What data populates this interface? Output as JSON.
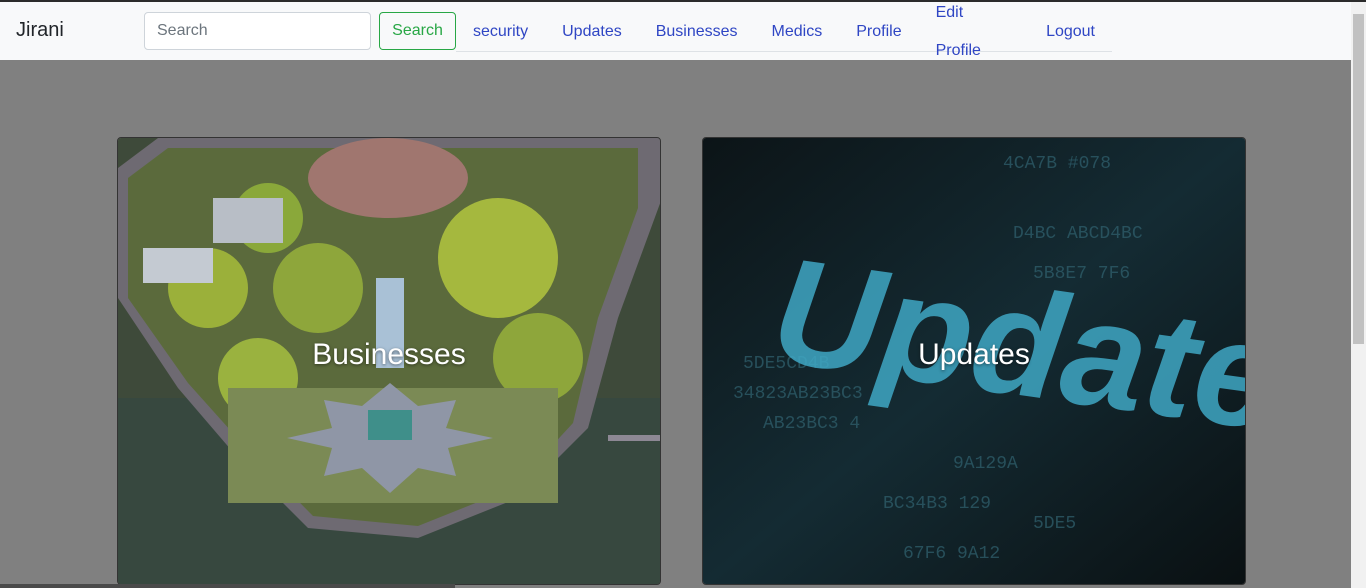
{
  "navbar": {
    "brand": "Jirani",
    "search": {
      "placeholder": "Search",
      "value": ""
    },
    "search_button": "Search",
    "links": [
      "security",
      "Updates",
      "Businesses",
      "Medics",
      "Profile",
      "Edit Profile",
      "Logout"
    ]
  },
  "cards": [
    {
      "title": "Businesses",
      "image": "aerial-island-photo"
    },
    {
      "title": "Updates",
      "image": "update-text-photo"
    }
  ],
  "colors": {
    "page_background": "#808080",
    "navbar_background": "#f8f9fa",
    "link": "#2f46c4",
    "search_button": "#28a745"
  }
}
